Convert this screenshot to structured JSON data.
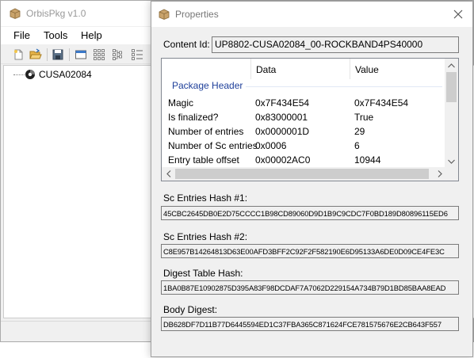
{
  "main_window": {
    "title": "OrbisPkg v1.0",
    "menu": [
      "File",
      "Tools",
      "Help"
    ],
    "toolbar_icons": [
      "new-file-icon",
      "open-folder-icon",
      "save-icon",
      "window-icon",
      "grid-icon",
      "tree-view-icon",
      "list-view-icon"
    ],
    "tree": [
      {
        "label": "CUSA02084",
        "icon": "disc-icon"
      }
    ]
  },
  "dialog": {
    "title": "Properties",
    "content_id_label": "Content Id:",
    "content_id_value": "UP8802-CUSA02084_00-ROCKBAND4PS40000",
    "list": {
      "columns": [
        "",
        "Data",
        "Value"
      ],
      "group": "Package Header",
      "rows": [
        {
          "name": "Magic",
          "data": "0x7F434E54",
          "value": "0x7F434E54"
        },
        {
          "name": "Is finalized?",
          "data": "0x83000001",
          "value": "True"
        },
        {
          "name": "Number of entries",
          "data": "0x0000001D",
          "value": "29"
        },
        {
          "name": "Number of Sc entries",
          "data": "0x0006",
          "value": "6"
        },
        {
          "name": "Entry table offset",
          "data": "0x00002AC0",
          "value": "10944"
        }
      ]
    },
    "hashes": [
      {
        "label": "Sc Entries Hash #1:",
        "value": "45CBC2645DB0E2D75CCCC1B98CD89060D9D1B9C9CDC7F0BD189D80896115ED6"
      },
      {
        "label": "Sc Entries Hash #2:",
        "value": "C8E957B14264813D63E00AFD3BFF2C92F2F582190E6D95133A6DE0D09CE4FE3C"
      },
      {
        "label": "Digest Table Hash:",
        "value": "1BA0B87E10902875D395A83F98DCDAF7A7062D229154A734B79D1BD85BAA8EAD"
      },
      {
        "label": "Body Digest:",
        "value": "DB628DF7D11B77D6445594ED1C37FBA365C871624FCE781575676E2CB643F557"
      }
    ]
  },
  "colors": {
    "group_header": "#1e3f9a",
    "window_bg": "#f0f0f0",
    "title_text_inactive": "#999999"
  }
}
